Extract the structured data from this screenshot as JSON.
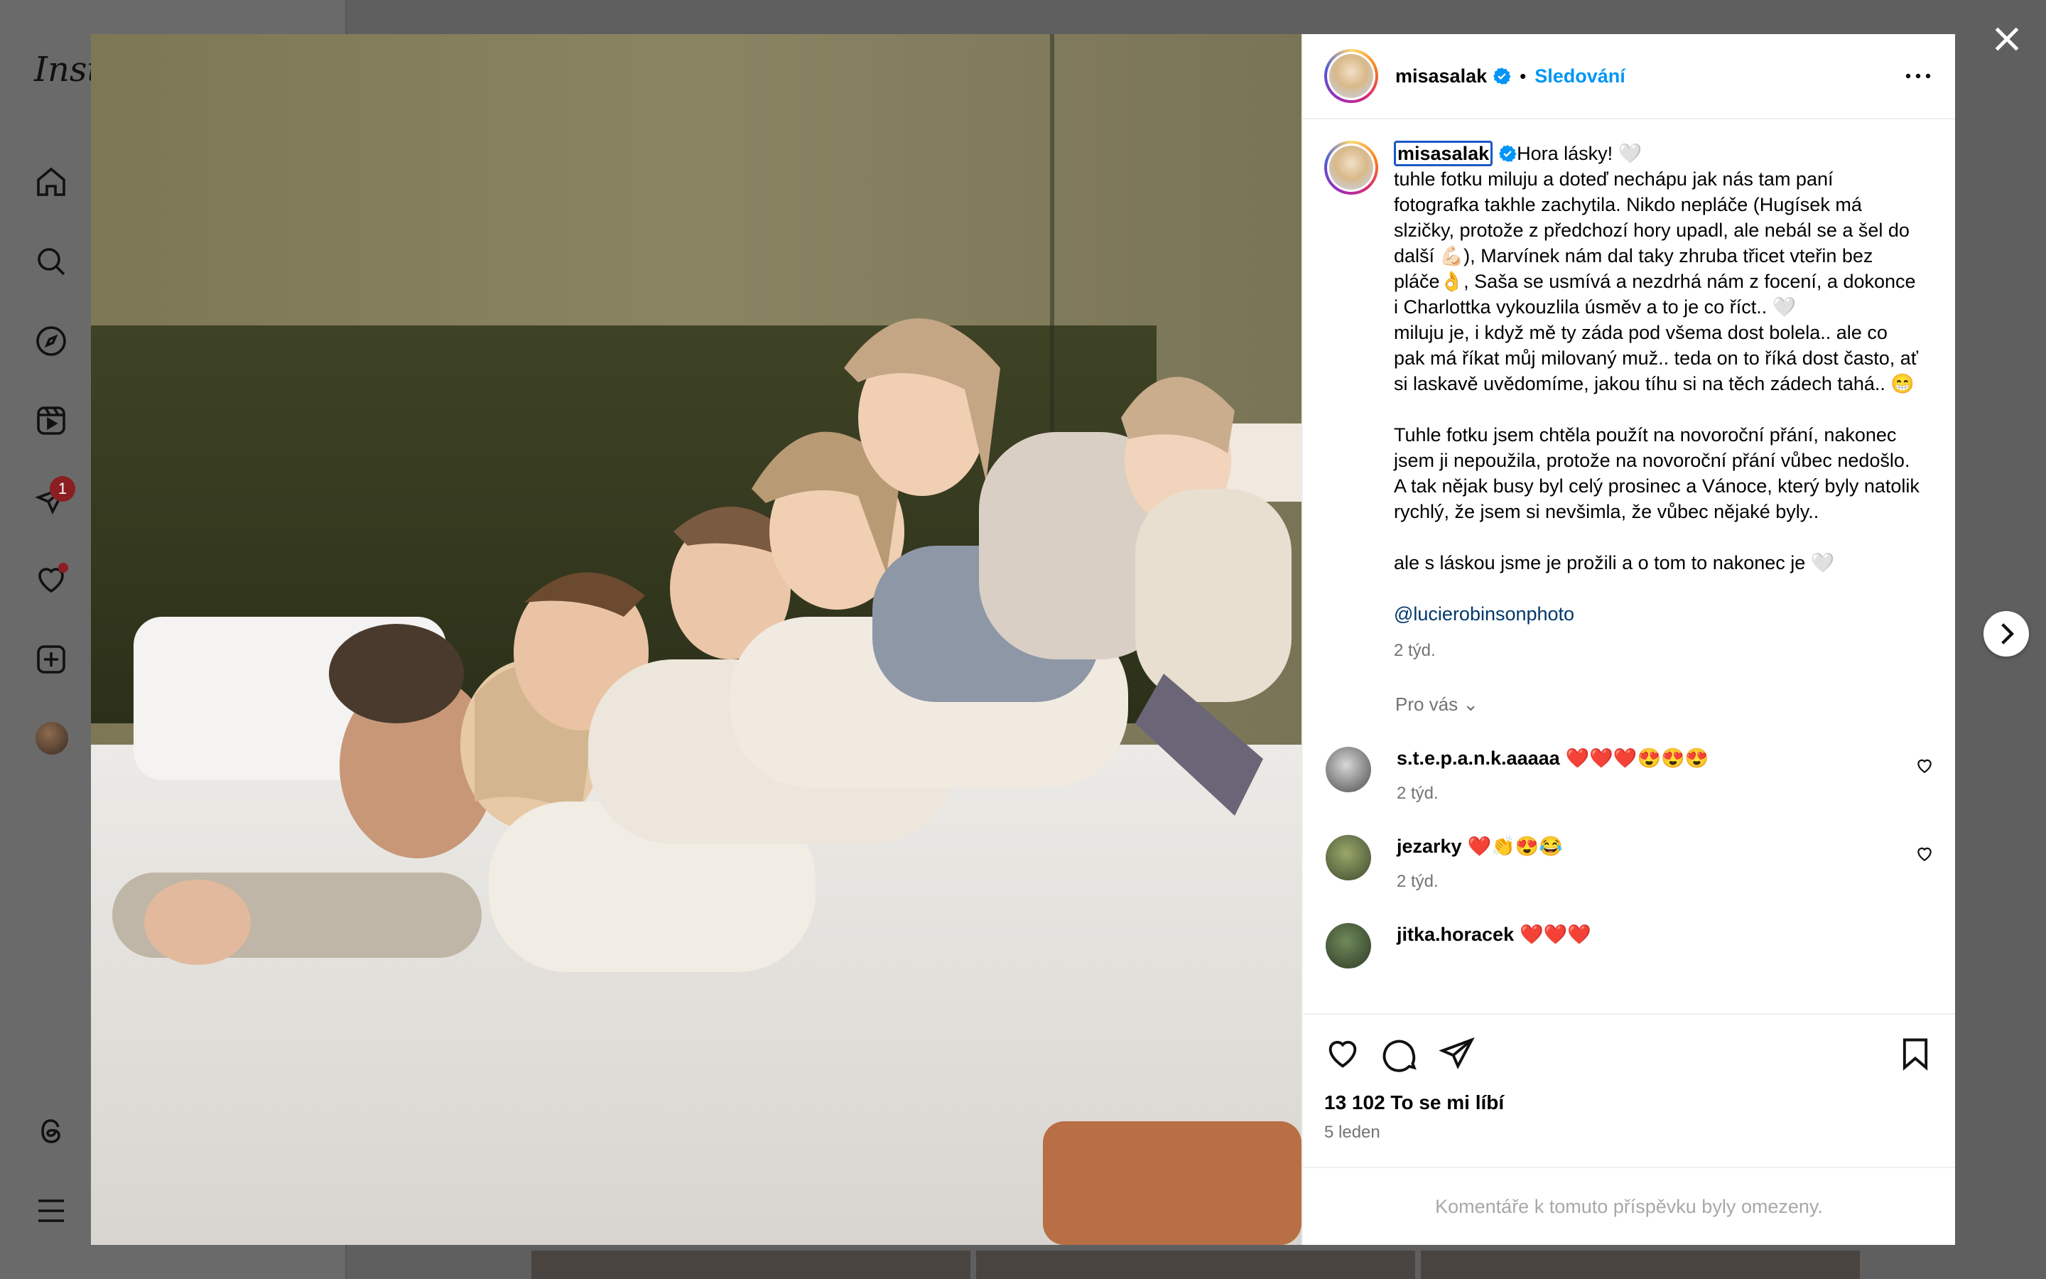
{
  "app": {
    "logo": "Inst"
  },
  "nav": {
    "items": [
      "home-icon",
      "search-icon",
      "explore-icon",
      "reels-icon",
      "messages-icon",
      "notifications-icon",
      "create-icon",
      "profile-avatar",
      "threads-icon",
      "menu-icon"
    ],
    "messages_badge": "1"
  },
  "post": {
    "author": "misasalak",
    "follow_label": "Sledování",
    "separator": "•",
    "caption_user": "misasalak",
    "caption_text": "Hora lásky! 🤍\ntuhle fotku miluju a doteď nechápu jak nás tam paní fotografka takhle zachytila. Nikdo nepláče (Hugísek má slzičky, protože z předchozí hory upadl, ale nebál se a šel do další 💪🏻), Marvínek nám dal taky zhruba třicet vteřin bez pláče👌, Saša se usmívá a nezdrhá nám z focení, a dokonce i Charlottka vykouzlila úsměv a to je co říct.. 🤍\nmiluju je, i když mě ty záda pod všema dost bolela.. ale co pak má říkat můj milovaný muž.. teda on to říká dost často, ať si laskavě uvědomíme, jakou tíhu si na těch zádech tahá.. 😁\n\nTuhle fotku jsem chtěla použít na novoroční přání, nakonec jsem ji nepoužila, protože na novoroční přání vůbec nedošlo. A tak nějak busy byl celý prosinec a Vánoce, který byly natolik rychlý, že jsem si nevšimla, že vůbec nějaké byly..\n\nale s láskou jsme je prožili a o tom to nakonec je 🤍\n\n",
    "mention": "@lucierobinsonphoto",
    "caption_time": "2 týd.",
    "for_you_label": "Pro vás",
    "comments": [
      {
        "user": "s.t.e.p.a.n.k.aaaaa",
        "text": "❤️❤️❤️😍😍😍",
        "time": "2 týd."
      },
      {
        "user": "jezarky",
        "text": "❤️👏😍😂",
        "time": "2 týd."
      },
      {
        "user": "jitka.horacek",
        "text": "❤️❤️❤️",
        "time": ""
      }
    ],
    "likes": "13 102 To se mi líbí",
    "date": "5 leden",
    "comments_limited": "Komentáře k tomuto příspěvku byly omezeny."
  },
  "colors": {
    "accent": "#0095f6",
    "mention": "#00376b",
    "muted": "#737373",
    "badge": "#8a1e22"
  }
}
